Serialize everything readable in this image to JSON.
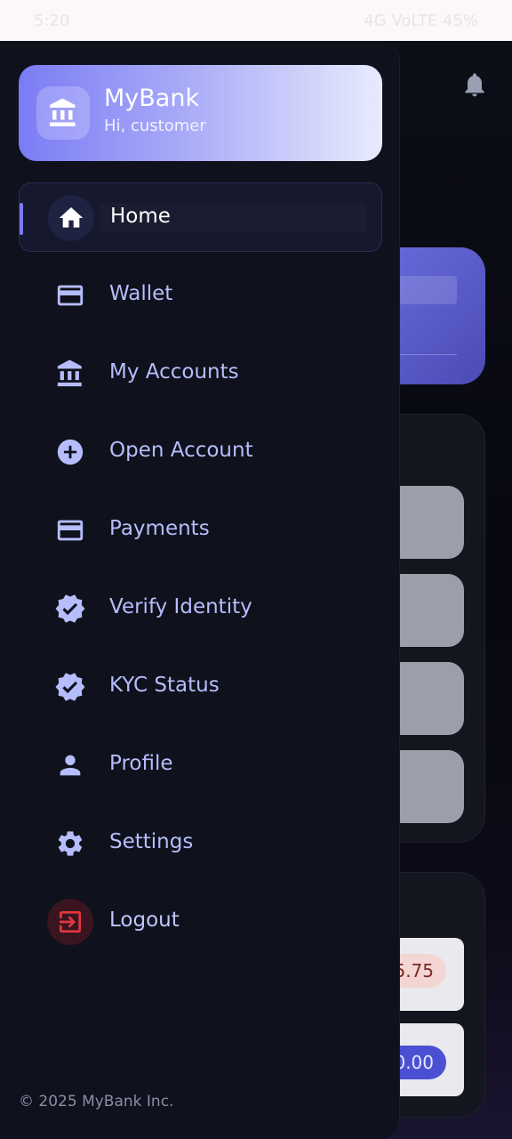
{
  "status_bar": {
    "time": "5:20",
    "right_text": "4G VoLTE 45%"
  },
  "drawer": {
    "header": {
      "title": "MyBank",
      "subtitle": "Hi, customer",
      "icon": "bank-icon"
    },
    "items": [
      {
        "label": "Home",
        "icon": "home-icon",
        "active": true
      },
      {
        "label": "Wallet",
        "icon": "card-icon"
      },
      {
        "label": "My Accounts",
        "icon": "bank-icon"
      },
      {
        "label": "Open Account",
        "icon": "add-circle-icon"
      },
      {
        "label": "Payments",
        "icon": "card-icon"
      },
      {
        "label": "Verify Identity",
        "icon": "verified-icon"
      },
      {
        "label": "KYC Status",
        "icon": "verified-icon"
      },
      {
        "label": "Profile",
        "icon": "person-icon"
      },
      {
        "label": "Settings",
        "icon": "gear-icon"
      },
      {
        "label": "Logout",
        "icon": "logout-icon"
      }
    ],
    "footer": "© 2025 MyBank Inc."
  },
  "background": {
    "chip_red": "5.75",
    "chip_blue": "0.00"
  },
  "colors": {
    "accent": "#7b7cf5",
    "nav_text": "#b6bdfb",
    "drawer_bg": "#0f111c",
    "logout": "#e2383f"
  }
}
